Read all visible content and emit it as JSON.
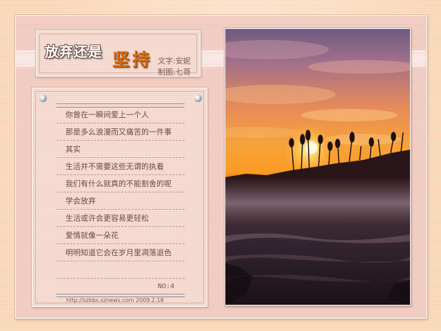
{
  "title": {
    "part1": "放弃还是",
    "part2": "坚持",
    "text_credit": "文字:安妮",
    "image_credit": "制图:七哥"
  },
  "poem": {
    "lines": [
      "你曾在一瞬间爱上一个人",
      "那是多么浪漫而又痛苦的一件事",
      "其实",
      "生活并不需要这些无谓的执着",
      "我们有什么就真的不能割舍的呢",
      "学会放弃",
      "生活或许会更容易更轻松",
      "爱情就像一朵花",
      "明明知道它会在岁月里凋落退色"
    ],
    "number": "NO:4",
    "footer": "http://szbbs.sznews.com 2009.2.18"
  },
  "photo": {
    "subject": "sunset-over-reeds-and-misty-water"
  },
  "colors": {
    "background": "#fadcc0",
    "frame": "#f2d0c6",
    "title_accent": "#d86a10",
    "text": "#6e4a44"
  }
}
